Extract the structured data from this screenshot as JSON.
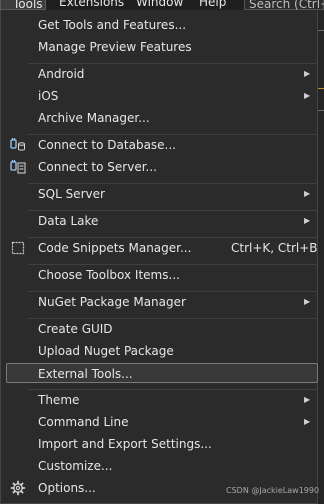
{
  "menubar": {
    "tools": "Tools",
    "extensions": "Extensions",
    "window": "Window",
    "help": "Help",
    "search": "Search (Ctrl+Q"
  },
  "menu": {
    "items": [
      {
        "label": "Get Tools and Features..."
      },
      {
        "label": "Manage Preview Features"
      },
      {
        "label": "Android"
      },
      {
        "label": "iOS"
      },
      {
        "label": "Archive Manager..."
      },
      {
        "label": "Connect to Database..."
      },
      {
        "label": "Connect to Server..."
      },
      {
        "label": "SQL Server"
      },
      {
        "label": "Data Lake"
      },
      {
        "label": "Code Snippets Manager...",
        "shortcut": "Ctrl+K, Ctrl+B"
      },
      {
        "label": "Choose Toolbox Items..."
      },
      {
        "label": "NuGet Package Manager"
      },
      {
        "label": "Create GUID"
      },
      {
        "label": "Upload Nuget Package"
      },
      {
        "label": "External Tools..."
      },
      {
        "label": "Theme"
      },
      {
        "label": "Command Line"
      },
      {
        "label": "Import and Export Settings..."
      },
      {
        "label": "Customize..."
      },
      {
        "label": "Options..."
      }
    ]
  },
  "watermark": "CSDN @JackieLaw1990",
  "colors": {
    "menu_bg": "#2b2b2b",
    "highlight_bg": "#383838",
    "highlight_border": "#7a7a7a",
    "text": "#e6e6e6",
    "db_icon": "#9cc9f0"
  }
}
